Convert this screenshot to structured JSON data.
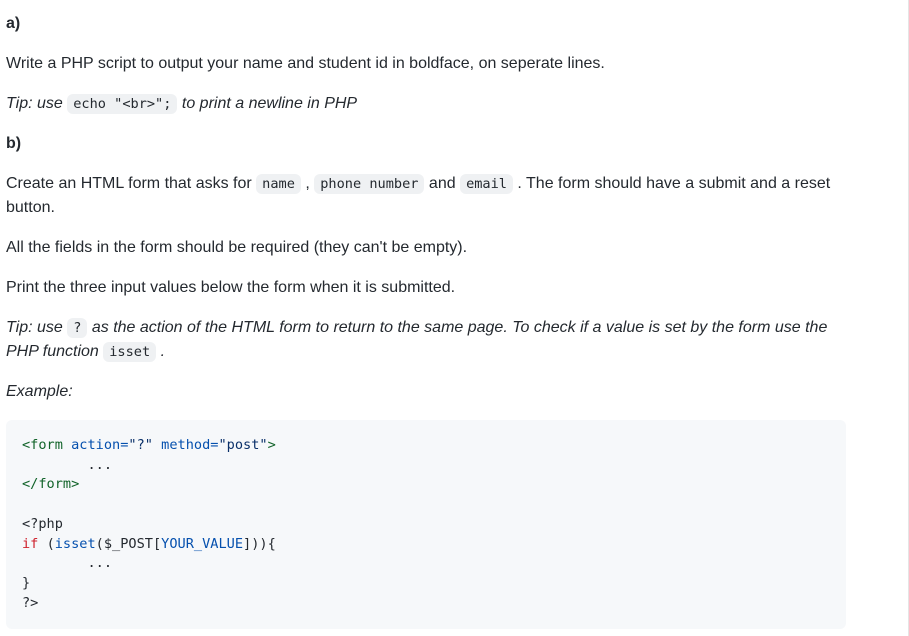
{
  "section_a": {
    "heading": "a)",
    "text": "Write a PHP script to output your name and student id in boldface, on seperate lines.",
    "tip_prefix": "Tip: use ",
    "tip_code": "echo \"<br>\";",
    "tip_suffix": " to print a newline in PHP"
  },
  "section_b": {
    "heading": "b)",
    "intro_prefix": "Create an HTML form that asks for ",
    "code_name": "name",
    "sep1": " , ",
    "code_phone": "phone number",
    "sep2": " and ",
    "code_email": "email",
    "intro_suffix": " . The form should have a submit and a reset button.",
    "required_text": "All the fields in the form should be required (they can't be empty).",
    "print_text": "Print the three input values below the form when it is submitted.",
    "tip2_prefix": "Tip: use ",
    "tip2_code_q": "?",
    "tip2_mid": " as the action of the HTML form to return to the same page. To check if a value is set by the form use the PHP function ",
    "tip2_code_isset": "isset",
    "tip2_suffix": " .",
    "example_label": "Example:"
  },
  "codeblock": {
    "l1_open": "<form",
    "l1_attr1_name": " action=",
    "l1_attr1_val": "\"?\"",
    "l1_attr2_name": " method=",
    "l1_attr2_val": "\"post\"",
    "l1_close": ">",
    "l2": "        ...",
    "l3": "</form>",
    "blank": "",
    "l5": "<?php",
    "l6_if": "if",
    "l6_sp": " ",
    "l6_open": "(",
    "l6_isset": "isset",
    "l6_p1": "(",
    "l6_var": "$_POST",
    "l6_b1": "[",
    "l6_const": "YOUR_VALUE",
    "l6_b2": "]",
    "l6_p2": ")",
    "l6_p3": ")",
    "l6_brace": "{",
    "l7": "        ...",
    "l8": "}",
    "l9": "?>"
  }
}
